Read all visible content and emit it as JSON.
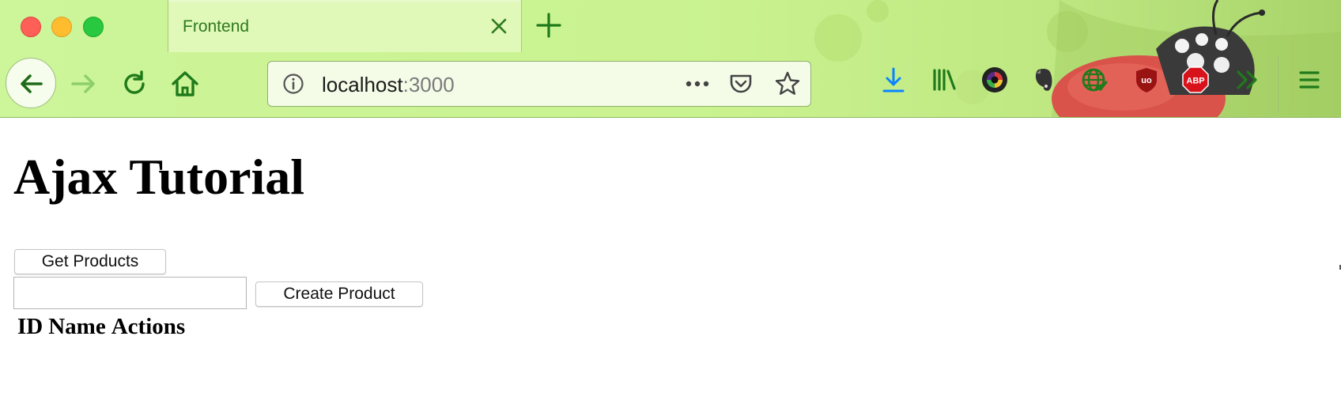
{
  "window": {
    "tab": {
      "title": "Frontend"
    }
  },
  "address_bar": {
    "host": "localhost",
    "port": ":3000"
  },
  "toolbar_icons": [
    "download-icon",
    "library-icon",
    "camera-extension-icon",
    "evernote-icon",
    "globe-extension-icon",
    "ublock-icon",
    "adblock-plus-icon",
    "overflow-chevron-icon",
    "hamburger-menu-icon"
  ],
  "colors": {
    "theme_green": "#c9f28f",
    "icon_green": "#1f7a1a",
    "download_blue": "#0a84ff"
  },
  "page": {
    "title": "Ajax Tutorial",
    "get_products_label": "Get Products",
    "product_name_value": "",
    "create_product_label": "Create Product",
    "table_headers": [
      "ID",
      "Name",
      "Actions"
    ]
  }
}
